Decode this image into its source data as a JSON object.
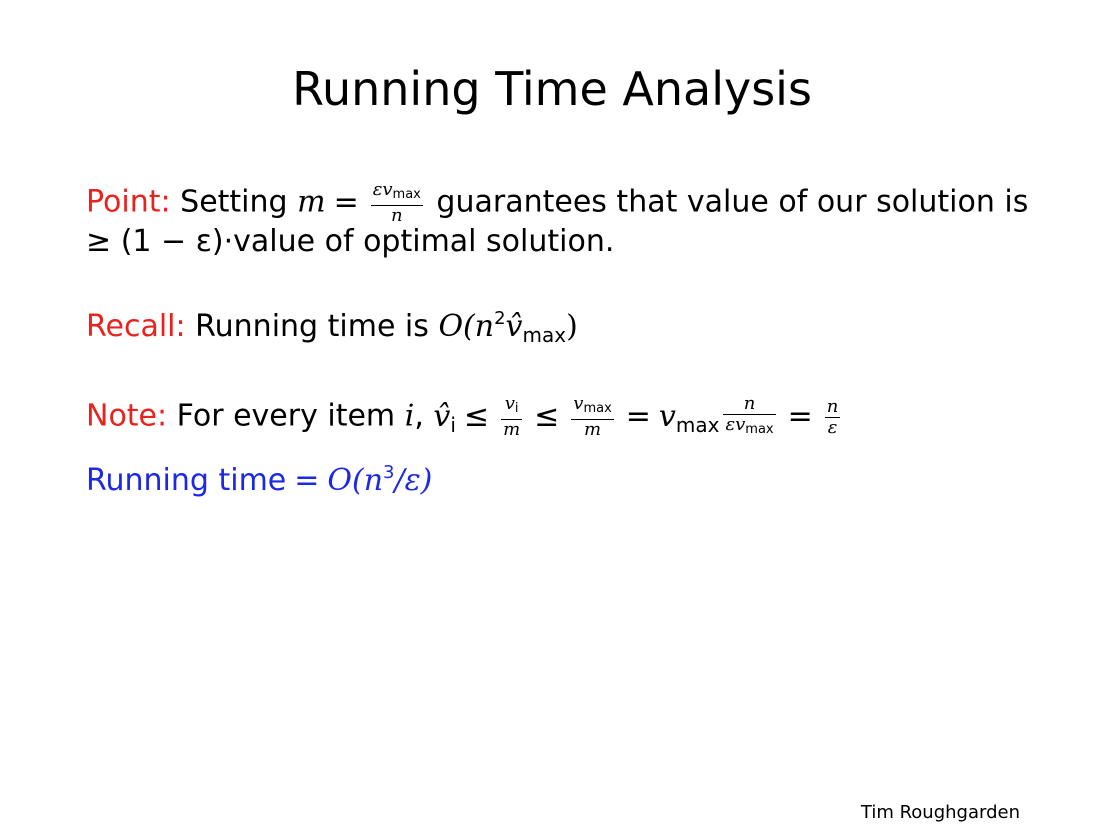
{
  "slide": {
    "title": "Running Time Analysis",
    "point": {
      "label": "Point:",
      "text_before": "Setting",
      "var_m": "m",
      "eq": "=",
      "frac_num": "εv",
      "frac_num_sub": "max",
      "frac_den": "n",
      "text_after": "guarantees that value of our solution is",
      "line2_geq": "≥",
      "line2_math": "(1 − ε)",
      "line2_text": "·value of optimal solution."
    },
    "recall": {
      "label": "Recall:",
      "text": "Running time is",
      "expr_O": "O(n",
      "expr_sup": "2",
      "expr_v": "v̂",
      "expr_sub": "max",
      "expr_close": ")"
    },
    "note": {
      "label": "Note:",
      "text": "For every item",
      "var_i": "i",
      "comma": ",",
      "vhat": "v̂",
      "vhat_sub": "i",
      "le1": "≤",
      "f1_num": "v",
      "f1_num_sub": "i",
      "f1_den": "m",
      "le2": "≤",
      "f2_num": "v",
      "f2_num_sub": "max",
      "f2_den": "m",
      "eq1": "=",
      "vmax": "v",
      "vmax_sub": "max",
      "f3_num": "n",
      "f3_den": "εv",
      "f3_den_sub": "max",
      "eq2": "=",
      "f4_num": "n",
      "f4_den": "ε"
    },
    "result": {
      "text": "Running time",
      "eq": "=",
      "expr": "O(n",
      "sup": "3",
      "expr_end": "/ε)"
    },
    "footer": "Tim Roughgarden"
  }
}
